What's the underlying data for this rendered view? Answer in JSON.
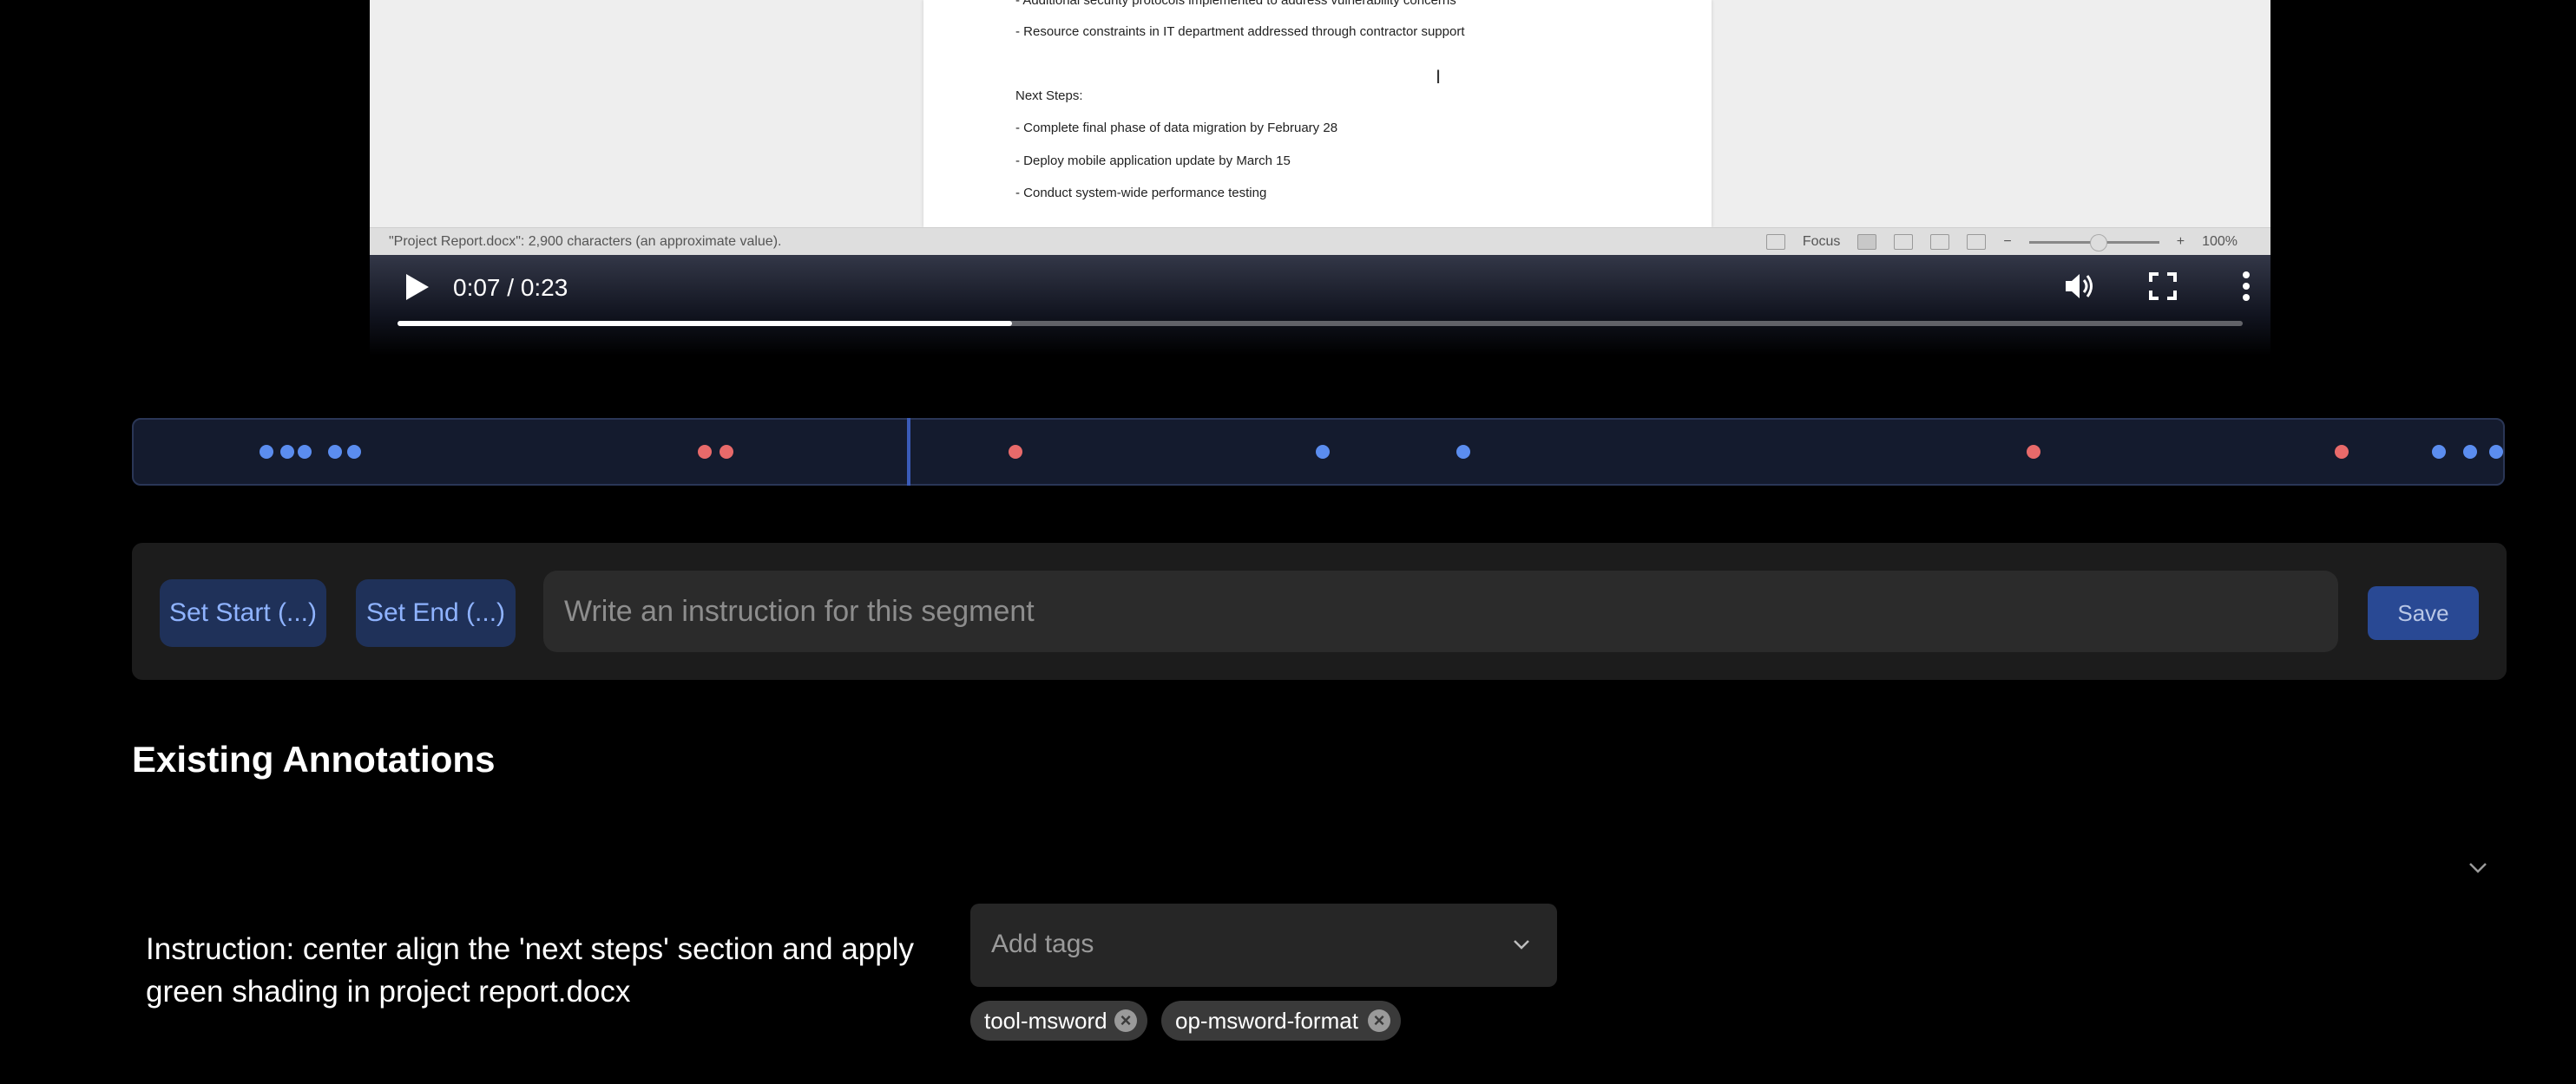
{
  "video": {
    "document_lines": [
      "- Additional security protocols implemented to address vulnerability concerns",
      "- Resource constraints in IT department addressed through contractor support",
      "Next Steps:",
      "- Complete final phase of data migration by February 28",
      "- Deploy mobile application update by March 15",
      "- Conduct system-wide performance testing"
    ],
    "status_bar": {
      "char_count": "\"Project Report.docx\": 2,900 characters (an approximate value).",
      "focus_label": "Focus",
      "zoom_percent": "100%",
      "zoom_minus": "−",
      "zoom_plus": "+"
    },
    "time_display": "0:07 / 0:23",
    "progress": 0.333
  },
  "timeline": {
    "playhead": 0.327,
    "markers": [
      {
        "pos": 0.056,
        "color": "#5b8def"
      },
      {
        "pos": 0.065,
        "color": "#5b8def"
      },
      {
        "pos": 0.072,
        "color": "#5b8def"
      },
      {
        "pos": 0.085,
        "color": "#5b8def"
      },
      {
        "pos": 0.093,
        "color": "#5b8def"
      },
      {
        "pos": 0.241,
        "color": "#e86a6a"
      },
      {
        "pos": 0.25,
        "color": "#e86a6a"
      },
      {
        "pos": 0.372,
        "color": "#e86a6a"
      },
      {
        "pos": 0.502,
        "color": "#5b8def"
      },
      {
        "pos": 0.561,
        "color": "#5b8def"
      },
      {
        "pos": 0.802,
        "color": "#e86a6a"
      },
      {
        "pos": 0.932,
        "color": "#e86a6a"
      },
      {
        "pos": 0.973,
        "color": "#5b8def"
      },
      {
        "pos": 0.986,
        "color": "#5b8def"
      },
      {
        "pos": 0.997,
        "color": "#5b8def"
      }
    ]
  },
  "editor": {
    "set_start_label": "Set Start (...)",
    "set_end_label": "Set End (...)",
    "instruction_placeholder": "Write an instruction for this segment",
    "save_label": "Save"
  },
  "existing": {
    "heading": "Existing Annotations",
    "items": [
      {
        "instruction": "Instruction: center align the 'next steps' section and apply green shading in project report.docx",
        "tags_placeholder": "Add tags",
        "tags": [
          "tool-msword",
          "op-msword-format"
        ]
      }
    ]
  }
}
